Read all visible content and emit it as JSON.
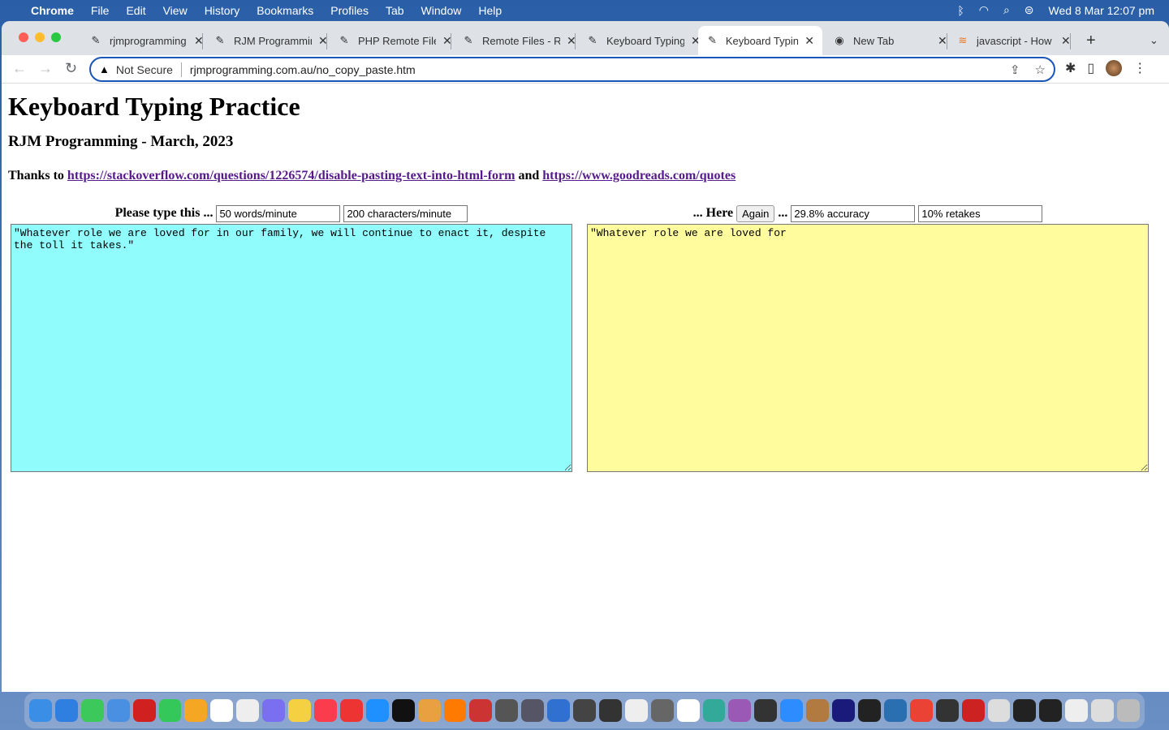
{
  "menubar": {
    "app": "Chrome",
    "items": [
      "File",
      "Edit",
      "View",
      "History",
      "Bookmarks",
      "Profiles",
      "Tab",
      "Window",
      "Help"
    ],
    "datetime": "Wed 8 Mar  12:07 pm"
  },
  "tabs": [
    {
      "title": "rjmprogramming",
      "active": false
    },
    {
      "title": "RJM Programming",
      "active": false
    },
    {
      "title": "PHP Remote Files",
      "active": false
    },
    {
      "title": "Remote Files - RJM",
      "active": false
    },
    {
      "title": "Keyboard Typing",
      "active": false
    },
    {
      "title": "Keyboard Typing",
      "active": true
    },
    {
      "title": "New Tab",
      "active": false
    },
    {
      "title": "javascript - How",
      "active": false
    }
  ],
  "omnibox": {
    "security": "Not Secure",
    "url": "rjmprogramming.com.au/no_copy_paste.htm"
  },
  "page": {
    "title": "Keyboard Typing Practice",
    "subtitle": "RJM Programming - March, 2023",
    "thanks_prefix": "Thanks to ",
    "link1": "https://stackoverflow.com/questions/1226574/disable-pasting-text-into-html-form",
    "and": " and ",
    "link2": "https://www.goodreads.com/quotes",
    "left": {
      "label": "Please type this ...",
      "wpm": "50 words/minute",
      "cpm": "200 characters/minute",
      "text": "\"Whatever role we are loved for in our family, we will continue to enact it, despite the toll it takes.\"",
      "bg": "#90fcfc"
    },
    "right": {
      "label": "... Here",
      "again": "Again",
      "sep": "...",
      "accuracy": "29.8% accuracy",
      "retakes": "10% retakes",
      "text": "\"Whatever role we are loved for",
      "bg": "#fefc9c"
    }
  }
}
